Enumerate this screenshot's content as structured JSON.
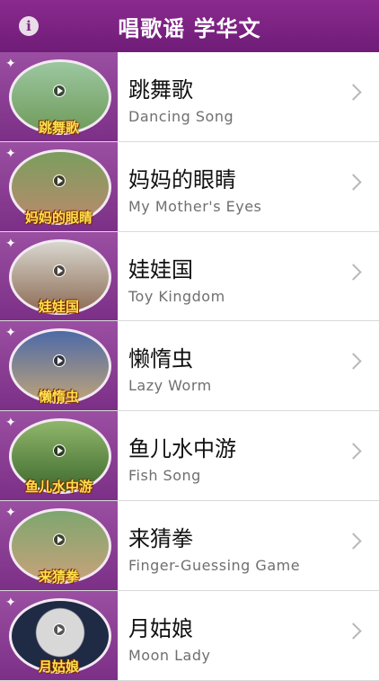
{
  "header": {
    "title": "唱歌谣 学华文",
    "info_icon": "i"
  },
  "items": [
    {
      "title": "跳舞歌",
      "subtitle": "Dancing Song",
      "caption": "跳舞歌",
      "bg": "linear-gradient(#9cc7a0,#6f9b5b)"
    },
    {
      "title": "妈妈的眼睛",
      "subtitle": "My Mother's Eyes",
      "caption": "妈妈的眼睛",
      "bg": "linear-gradient(#7b9e5e,#b98a6d)"
    },
    {
      "title": "娃娃国",
      "subtitle": "Toy Kingdom",
      "caption": "娃娃国",
      "bg": "linear-gradient(#d8d6ce,#8d6c55)"
    },
    {
      "title": "懒惰虫",
      "subtitle": "Lazy Worm",
      "caption": "懒惰虫",
      "bg": "linear-gradient(#4d6aa7,#bda27a)"
    },
    {
      "title": "鱼儿水中游",
      "subtitle": "Fish Song",
      "caption": "鱼儿水中游",
      "bg": "linear-gradient(#8fb66b,#3f6a2e)"
    },
    {
      "title": "来猜拳",
      "subtitle": "Finger-Guessing Game",
      "caption": "来猜拳",
      "bg": "linear-gradient(#7ea66f,#c7a27a)"
    },
    {
      "title": "月姑娘",
      "subtitle": "Moon Lady",
      "caption": "月姑娘",
      "bg": "radial-gradient(circle at 50% 45%, #d8d8d8 0 38%, #1f2a44 40%)"
    }
  ]
}
